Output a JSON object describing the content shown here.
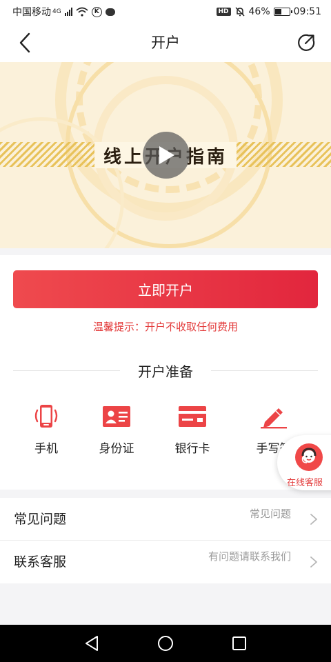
{
  "status_bar": {
    "carrier": "中国移动",
    "network": "4G",
    "battery_percent": "46%",
    "time": "09:51",
    "icons": [
      "signal-icon",
      "wifi-icon",
      "k-circle-icon",
      "message-icon",
      "hd-icon",
      "mute-bell-icon",
      "battery-icon"
    ]
  },
  "header": {
    "title": "开户",
    "back_icon": "chevron-left-icon",
    "share_icon": "share-icon"
  },
  "banner": {
    "title": "线上开户指南",
    "play_icon": "play-icon"
  },
  "main": {
    "open_button_label": "立即开户",
    "tip": "温馨提示：开户不收取任何费用",
    "section_title": "开户准备",
    "prep_items": [
      {
        "label": "手机",
        "icon": "phone-icon"
      },
      {
        "label": "身份证",
        "icon": "id-card-icon"
      },
      {
        "label": "银行卡",
        "icon": "bank-card-icon"
      },
      {
        "label": "手写签",
        "icon": "pen-icon"
      }
    ]
  },
  "float_service": {
    "label": "在线客服",
    "icon": "customer-service-icon"
  },
  "list": [
    {
      "title": "常见问题",
      "hint": "常见问题"
    },
    {
      "title": "联系客服",
      "hint": "有问题请联系我们"
    }
  ],
  "nav_bar": {
    "icons": [
      "back-triangle-icon",
      "home-circle-icon",
      "recents-square-icon"
    ]
  },
  "colors": {
    "accent_red": "#e8303f",
    "tip_red": "#e33b3b",
    "banner_bg": "#fbf1da"
  }
}
